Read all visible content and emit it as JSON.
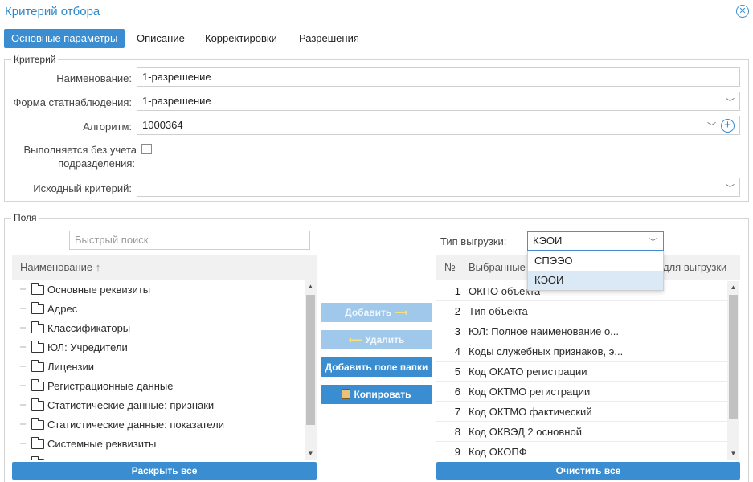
{
  "window": {
    "title": "Критерий отбора"
  },
  "tabs": [
    {
      "label": "Основные параметры",
      "active": true
    },
    {
      "label": "Описание",
      "active": false
    },
    {
      "label": "Корректировки",
      "active": false
    },
    {
      "label": "Разрешения",
      "active": false
    }
  ],
  "criteria": {
    "legend": "Критерий",
    "name_label": "Наименование:",
    "name_value": "1-разрешение",
    "form_label": "Форма статнаблюдения:",
    "form_value": "1-разрешение",
    "algo_label": "Алгоритм:",
    "algo_value": "1000364",
    "nodept_label_1": "Выполняется без учета",
    "nodept_label_2": "подразделения:",
    "nodept_checked": false,
    "source_label": "Исходный критерий:",
    "source_value": ""
  },
  "fields": {
    "legend": "Поля",
    "search_placeholder": "Быстрый поиск",
    "tree_header": "Наименование",
    "tree_items": [
      "Основные реквизиты",
      "Адрес",
      "Классификаторы",
      "ЮЛ: Учредители",
      "Лицензии",
      "Регистрационные данные",
      "Статистические данные: признаки",
      "Статистические данные: показатели",
      "Системные реквизиты"
    ],
    "expand_all": "Раскрыть все",
    "add_btn": "Добавить",
    "remove_btn": "Удалить",
    "add_folder_btn": "Добавить поле папки",
    "copy_btn": "Копировать",
    "export_type_label": "Тип выгрузки:",
    "export_type_value": "КЭОИ",
    "export_type_options": [
      "СПЭЭО",
      "КЭОИ"
    ],
    "grid_col_num": "№",
    "grid_col_name_left": "Выбранные",
    "grid_col_name_right": "для выгрузки",
    "grid_rows": [
      {
        "num": "1",
        "name": "ОКПО объекта"
      },
      {
        "num": "2",
        "name": "Тип объекта"
      },
      {
        "num": "3",
        "name": "ЮЛ: Полное наименование о..."
      },
      {
        "num": "4",
        "name": "Коды служебных признаков, э..."
      },
      {
        "num": "5",
        "name": "Код ОКАТО регистрации"
      },
      {
        "num": "6",
        "name": "Код ОКТМО регистрации"
      },
      {
        "num": "7",
        "name": "Код ОКТМО фактический"
      },
      {
        "num": "8",
        "name": "Код ОКВЭД 2 основной"
      },
      {
        "num": "9",
        "name": "Код ОКОПФ"
      }
    ],
    "clear_all": "Очистить все"
  },
  "colors": {
    "accent": "#3a8dd0",
    "title": "#2e87c8"
  }
}
